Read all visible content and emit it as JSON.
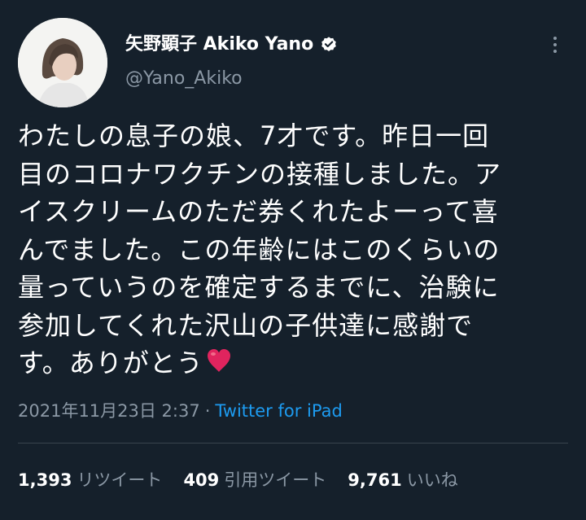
{
  "author": {
    "name": "矢野顕子 Akiko Yano",
    "handle": "@Yano_Akiko"
  },
  "icons": {
    "avatar": "profile-photo",
    "verified": "verified-badge-icon",
    "more": "more-options-icon",
    "heart": "red-heart-emoji"
  },
  "tweet": {
    "text": "わたしの息子の娘、7才です。昨日一回\n目のコロナワクチンの接種しました。ア\nイスクリームのただ券くれたよーって喜\nんでました。この年齢にはこのくらいの\n量っていうのを確定するまでに、治験に\n参加してくれた沢山の子供達に感謝で\nす。ありがとう"
  },
  "meta": {
    "timestamp": "2021年11月23日 2:37",
    "separator": "·",
    "source": "Twitter for iPad"
  },
  "stats": {
    "retweets_count": "1,393",
    "retweets_label": "リツイート",
    "quotes_count": "409",
    "quotes_label": "引用ツイート",
    "likes_count": "9,761",
    "likes_label": "いいね"
  },
  "colors": {
    "background": "#15202b",
    "text": "#ffffff",
    "muted": "#8b98a5",
    "link": "#1d9bf0",
    "divider": "#38444d",
    "heart": "#e0245e"
  }
}
